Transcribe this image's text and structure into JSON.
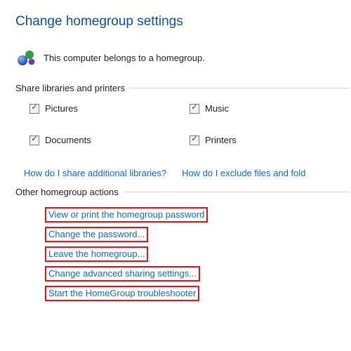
{
  "title": "Change homegroup settings",
  "status_text": "This computer belongs to a homegroup.",
  "share_section_label": "Share libraries and printers",
  "checks": {
    "pictures": "Pictures",
    "music": "Music",
    "documents": "Documents",
    "printers": "Printers"
  },
  "help": {
    "share_additional": "How do I share additional libraries?",
    "exclude": "How do I exclude files and fold"
  },
  "other_section_label": "Other homegroup actions",
  "actions": {
    "view_password": "View or print the homegroup password",
    "change_password": "Change the password...",
    "leave": "Leave the homegroup...",
    "advanced": "Change advanced sharing settings...",
    "troubleshooter": "Start the HomeGroup troubleshooter"
  }
}
